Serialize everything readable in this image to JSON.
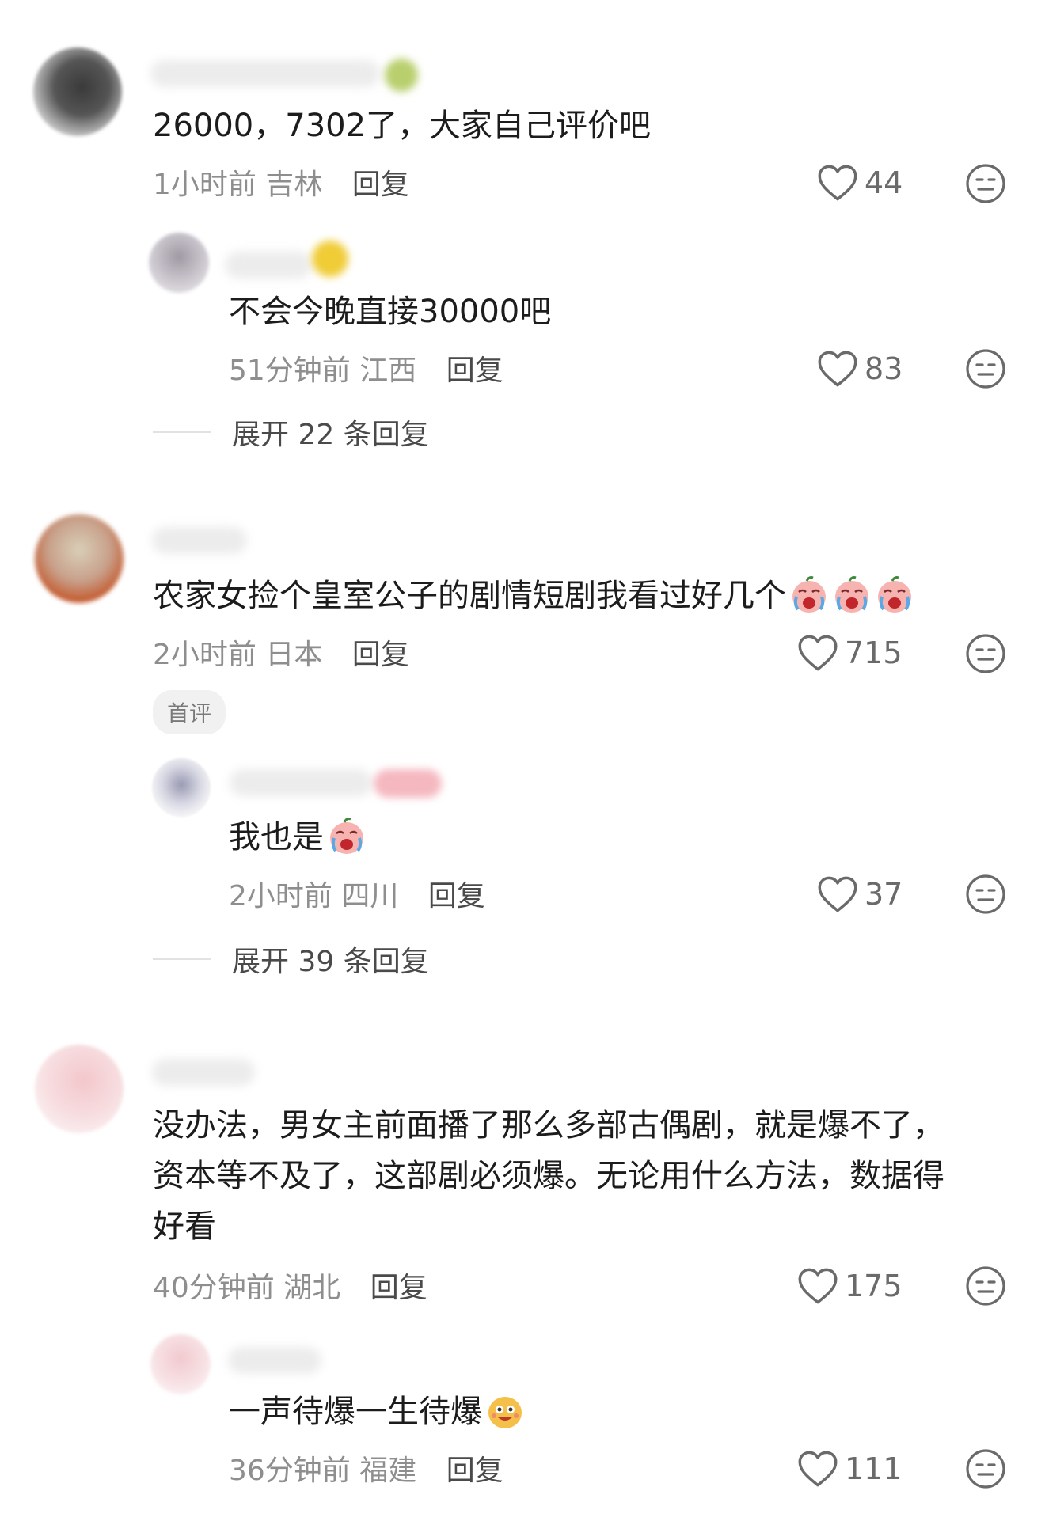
{
  "comments": [
    {
      "text": "26000，7302了，大家自己评价吧",
      "time": "1小时前",
      "location": "吉林",
      "reply_label": "回复",
      "likes": "44",
      "replies": [
        {
          "text": "不会今晚直接30000吧",
          "time": "51分钟前",
          "location": "江西",
          "reply_label": "回复",
          "likes": "83"
        }
      ],
      "expand_label": "展开 22 条回复"
    },
    {
      "text": "农家女捡个皇室公子的剧情短剧我看过好几个",
      "emoji": "crying-face-emoji",
      "emoji_count": 3,
      "time": "2小时前",
      "location": "日本",
      "reply_label": "回复",
      "likes": "715",
      "tag": "首评",
      "replies": [
        {
          "text": "我也是",
          "emoji": "crying-face-emoji",
          "time": "2小时前",
          "location": "四川",
          "reply_label": "回复",
          "likes": "37"
        }
      ],
      "expand_label": "展开 39 条回复"
    },
    {
      "text_lines": [
        "没办法，男女主前面播了那么多部古偶剧，就是爆不了，",
        "资本等不及了，这部剧必须爆。无论用什么方法，数据得",
        "好看"
      ],
      "time": "40分钟前",
      "location": "湖北",
      "reply_label": "回复",
      "likes": "175",
      "replies": [
        {
          "text": "一声待爆一生待爆",
          "emoji": "grinning-face-emoji",
          "time": "36分钟前",
          "location": "福建",
          "reply_label": "回复",
          "likes": "111"
        }
      ]
    }
  ],
  "colors": {
    "text": "#1c1c1c",
    "meta": "#8e8e8e",
    "reply": "#4a4a4a",
    "icon": "#6a6a6a"
  }
}
